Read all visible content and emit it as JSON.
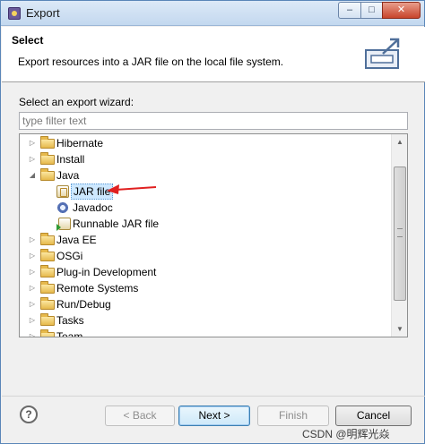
{
  "window": {
    "title": "Export",
    "controls": {
      "minimize": "–",
      "maximize": "□",
      "close": "✕"
    }
  },
  "banner": {
    "title": "Select",
    "description": "Export resources into a JAR file on the local file system."
  },
  "wizard": {
    "label": "Select an export wizard:",
    "filter_placeholder": "type filter text",
    "tree": [
      {
        "label": "Hibernate",
        "type": "folder",
        "expanded": false,
        "depth": 0
      },
      {
        "label": "Install",
        "type": "folder",
        "expanded": false,
        "depth": 0
      },
      {
        "label": "Java",
        "type": "folder",
        "expanded": true,
        "depth": 0
      },
      {
        "label": "JAR file",
        "type": "jar",
        "selected": true,
        "depth": 1
      },
      {
        "label": "Javadoc",
        "type": "javadoc",
        "depth": 1
      },
      {
        "label": "Runnable JAR file",
        "type": "runnable-jar",
        "depth": 1
      },
      {
        "label": "Java EE",
        "type": "folder",
        "expanded": false,
        "depth": 0
      },
      {
        "label": "OSGi",
        "type": "folder",
        "expanded": false,
        "depth": 0
      },
      {
        "label": "Plug-in Development",
        "type": "folder",
        "expanded": false,
        "depth": 0
      },
      {
        "label": "Remote Systems",
        "type": "folder",
        "expanded": false,
        "depth": 0
      },
      {
        "label": "Run/Debug",
        "type": "folder",
        "expanded": false,
        "depth": 0
      },
      {
        "label": "Tasks",
        "type": "folder",
        "expanded": false,
        "depth": 0
      },
      {
        "label": "Team",
        "type": "folder",
        "expanded": false,
        "depth": 0
      }
    ]
  },
  "buttons": {
    "help": "?",
    "back": "< Back",
    "next": "Next >",
    "finish": "Finish",
    "cancel": "Cancel"
  },
  "watermark": "CSDN @明辉光焱",
  "colors": {
    "title_bar": "#c3d8ef",
    "selection": "#cde8ff",
    "annotation_arrow": "#e02020",
    "close_button": "#c8452c"
  }
}
